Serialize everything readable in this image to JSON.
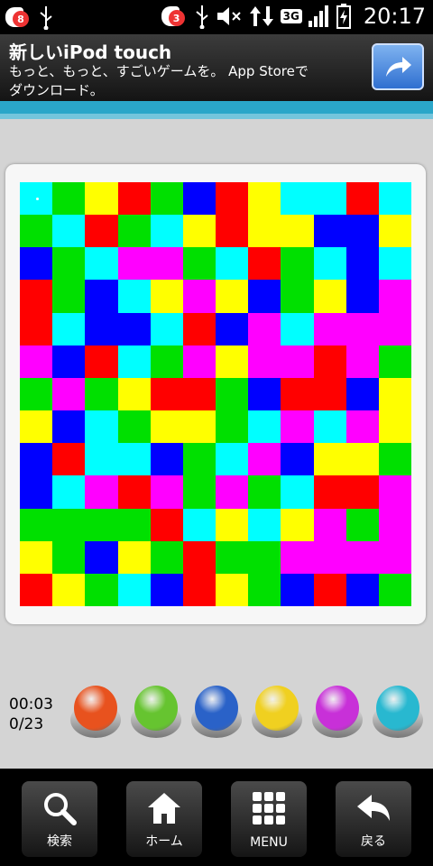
{
  "status_bar": {
    "notifications": [
      {
        "badge": "8"
      },
      {
        "badge": "3"
      }
    ],
    "network": "3G",
    "time": "20:17"
  },
  "ad_banner": {
    "title": "新しいiPod touch",
    "line1": "もっと、もっと、すごいゲームを。 App Storeで",
    "line2": "ダウンロード。",
    "share_icon": "share-arrow-icon"
  },
  "game": {
    "timer": "00:03",
    "moves": "0/23",
    "colors": {
      "C": "#00ffff",
      "G": "#00e000",
      "Y": "#ffff00",
      "R": "#ff0000",
      "B": "#0000ff",
      "M": "#ff00ff"
    },
    "grid": [
      "CGYRGBRYCCRC",
      "GCRGCYRYYBBY",
      "BGCMMGCRGCBC",
      "RGBCYMYBGYBM",
      "RCBBCRBMCMMM",
      "MBRCGMYMMRMG",
      "GMGYRRGBRRBY",
      "YBCGYYGCMCMY",
      "BRCCBGCMBYYG",
      "BCMRMGMGCRRM",
      "GGGGRCYCYMGM",
      "YGBYGRGGMMMM",
      "RYGCBRYGBRBG"
    ],
    "buttons": [
      {
        "name": "red",
        "color": "#e8521e"
      },
      {
        "name": "green",
        "color": "#66c430"
      },
      {
        "name": "blue",
        "color": "#2a62c8"
      },
      {
        "name": "yellow",
        "color": "#f0d020"
      },
      {
        "name": "magenta",
        "color": "#c830d8"
      },
      {
        "name": "cyan",
        "color": "#28b8d0"
      }
    ]
  },
  "nav_bar": {
    "search_label": "検索",
    "home_label": "ホーム",
    "menu_label": "MENU",
    "back_label": "戻る"
  }
}
